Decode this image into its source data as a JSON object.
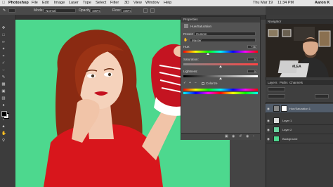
{
  "menubar": {
    "app": "Photoshop",
    "items": [
      "File",
      "Edit",
      "Image",
      "Layer",
      "Type",
      "Select",
      "Filter",
      "3D",
      "View",
      "Window",
      "Help"
    ],
    "datetime": "Thu Mar 19",
    "time": "11:34 PM",
    "user": "Aaron K"
  },
  "options": {
    "mode_label": "Mode:",
    "mode_value": "Normal",
    "opacity_label": "Opacity:",
    "opacity_value": "100%",
    "flow_label": "Flow:",
    "flow_value": "100%"
  },
  "properties": {
    "panel_title": "Properties",
    "adjustment_title": "Hue/Saturation",
    "preset_label": "Preset:",
    "preset_value": "Custom",
    "channel_value": "Master",
    "hue_label": "Hue:",
    "hue_value": "+36",
    "saturation_label": "Saturation:",
    "saturation_value": "0",
    "lightness_label": "Lightness:",
    "lightness_value": "0",
    "colorize_label": "Colorize"
  },
  "navigator": {
    "label": "Navigator"
  },
  "video": {
    "laptop_sticker": "#LEA"
  },
  "layers": {
    "tabs": [
      "Layers",
      "Paths",
      "Channels"
    ],
    "items": [
      {
        "name": "Hue/Saturation 1"
      },
      {
        "name": "Layer 1"
      },
      {
        "name": "Layer 2"
      },
      {
        "name": "Background"
      }
    ]
  },
  "colors": {
    "canvas_green": "#4dd88e",
    "panel_bg": "#535353",
    "dock_bg": "#3b3b3b"
  }
}
